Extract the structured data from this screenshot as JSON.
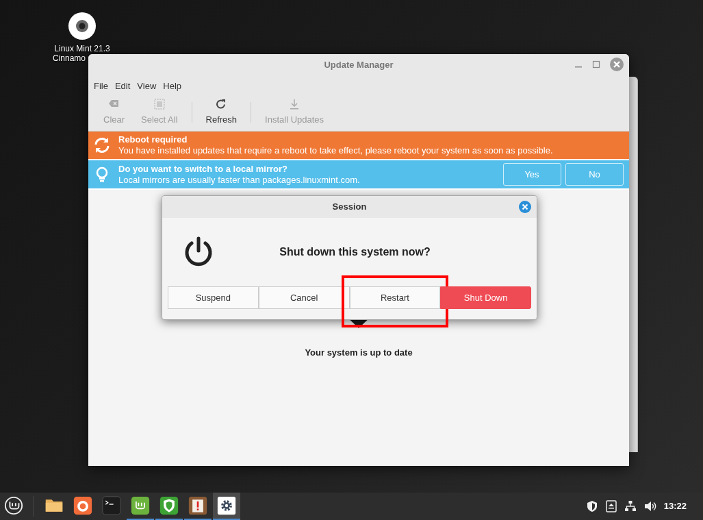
{
  "desktop_icons": [
    {
      "lines": [
        "Linux Mint 21.3",
        "Cinnamo"
      ]
    }
  ],
  "window": {
    "title": "Update Manager",
    "menu": [
      "File",
      "Edit",
      "View",
      "Help"
    ],
    "toolbar": [
      {
        "kind": "button",
        "label": "Clear",
        "disabled": true
      },
      {
        "kind": "button",
        "label": "Select All",
        "disabled": true
      },
      {
        "kind": "separator"
      },
      {
        "kind": "button",
        "label": "Refresh",
        "disabled": false
      },
      {
        "kind": "separator"
      },
      {
        "kind": "button",
        "label": "Install Updates",
        "disabled": true
      }
    ],
    "banners": [
      {
        "kind": "warning",
        "title": "Reboot required",
        "text": "You have installed updates that require a reboot to take effect, please reboot your system as soon as possible."
      },
      {
        "kind": "info",
        "title": "Do you want to switch to a local mirror?",
        "text": "Local mirrors are usually faster than packages.linuxmint.com.",
        "buttons": [
          "Yes",
          "No"
        ]
      }
    ],
    "status": "Your system is up to date"
  },
  "dialog": {
    "title": "Session",
    "question": "Shut down this system now?",
    "buttons": [
      {
        "label": "Suspend",
        "kind": "normal",
        "highlighted": false
      },
      {
        "label": "Cancel",
        "kind": "normal",
        "highlighted": false
      },
      {
        "label": "Restart",
        "kind": "normal",
        "highlighted": true
      },
      {
        "label": "Shut Down",
        "kind": "destructive",
        "highlighted": false
      }
    ]
  },
  "taskbar": {
    "apps": [
      {
        "running": false,
        "selected": false
      },
      {
        "running": false,
        "selected": false
      },
      {
        "running": false,
        "selected": false
      },
      {
        "running": true,
        "selected": false
      },
      {
        "running": true,
        "selected": false
      },
      {
        "running": true,
        "selected": false
      },
      {
        "running": true,
        "selected": true
      }
    ],
    "clock": "13:22"
  }
}
